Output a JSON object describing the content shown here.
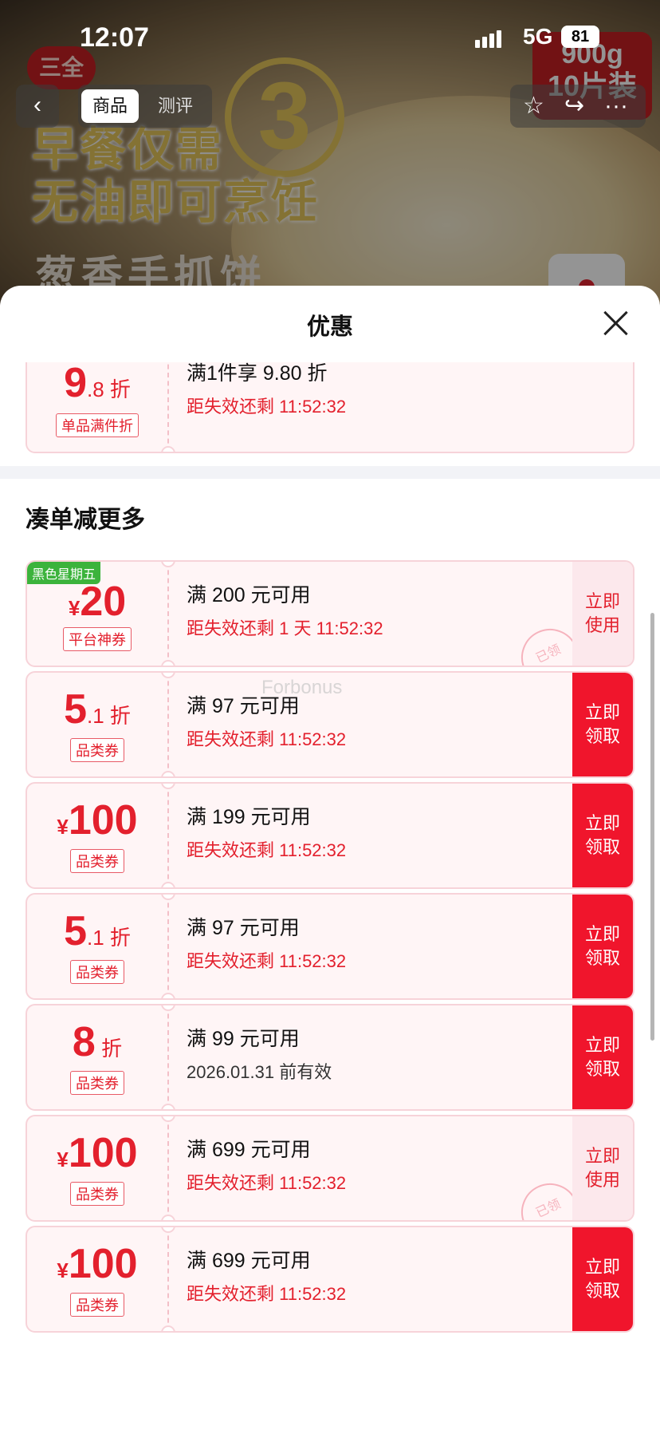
{
  "status_bar": {
    "time": "12:07",
    "network": "5G",
    "battery": "81"
  },
  "nav": {
    "back_glyph": "‹",
    "tabs": [
      {
        "label": "商品",
        "active": true
      },
      {
        "label": "测评",
        "active": false
      }
    ],
    "right_glyphs": [
      "☆",
      "↪",
      "···"
    ]
  },
  "hero": {
    "brand": "三全",
    "slogan_line1": "早餐仅需",
    "big_number": "3",
    "slogan_line2": "无油即可烹饪",
    "product_name": "葱香手抓饼",
    "pack_weight": "900g",
    "pack_count": "10片装"
  },
  "sheet": {
    "title": "优惠",
    "close_icon": "close-icon",
    "section_title": "凑单减更多",
    "watermark": "Forbonus"
  },
  "top_coupon": {
    "amount_big": "9",
    "amount_small": ".8 折",
    "type": "单品满件折",
    "condition": "满1件享 9.80 折",
    "expire": "距失效还剩 11:52:32"
  },
  "coupons": [
    {
      "tag": "黑色星期五",
      "yen": "¥",
      "amount_big": "20",
      "amount_small": "",
      "type": "平台神券",
      "condition": "满 200 元可用",
      "expire": "距失效还剩 1 天 11:52:32",
      "action_line1": "立即",
      "action_line2": "使用",
      "action_style": "use",
      "stamp": "已领"
    },
    {
      "tag": "",
      "yen": "",
      "amount_big": "5",
      "amount_small": ".1 折",
      "type": "品类券",
      "condition": "满 97 元可用",
      "expire": "距失效还剩 11:52:32",
      "action_line1": "立即",
      "action_line2": "领取",
      "action_style": "claim",
      "stamp": ""
    },
    {
      "tag": "",
      "yen": "¥",
      "amount_big": "100",
      "amount_small": "",
      "type": "品类券",
      "condition": "满 199 元可用",
      "expire": "距失效还剩 11:52:32",
      "action_line1": "立即",
      "action_line2": "领取",
      "action_style": "claim",
      "stamp": ""
    },
    {
      "tag": "",
      "yen": "",
      "amount_big": "5",
      "amount_small": ".1 折",
      "type": "品类券",
      "condition": "满 97 元可用",
      "expire": "距失效还剩 11:52:32",
      "action_line1": "立即",
      "action_line2": "领取",
      "action_style": "claim",
      "stamp": ""
    },
    {
      "tag": "",
      "yen": "",
      "amount_big": "8",
      "amount_small": " 折",
      "type": "品类券",
      "condition": "满 99 元可用",
      "expire": "2026.01.31 前有效",
      "expire_plain": true,
      "action_line1": "立即",
      "action_line2": "领取",
      "action_style": "claim",
      "stamp": ""
    },
    {
      "tag": "",
      "yen": "¥",
      "amount_big": "100",
      "amount_small": "",
      "type": "品类券",
      "condition": "满 699 元可用",
      "expire": "距失效还剩 11:52:32",
      "action_line1": "立即",
      "action_line2": "使用",
      "action_style": "use",
      "stamp": "已领"
    },
    {
      "tag": "",
      "yen": "¥",
      "amount_big": "100",
      "amount_small": "",
      "type": "品类券",
      "condition": "满 699 元可用",
      "expire": "距失效还剩 11:52:32",
      "action_line1": "立即",
      "action_line2": "领取",
      "action_style": "claim",
      "stamp": ""
    }
  ]
}
